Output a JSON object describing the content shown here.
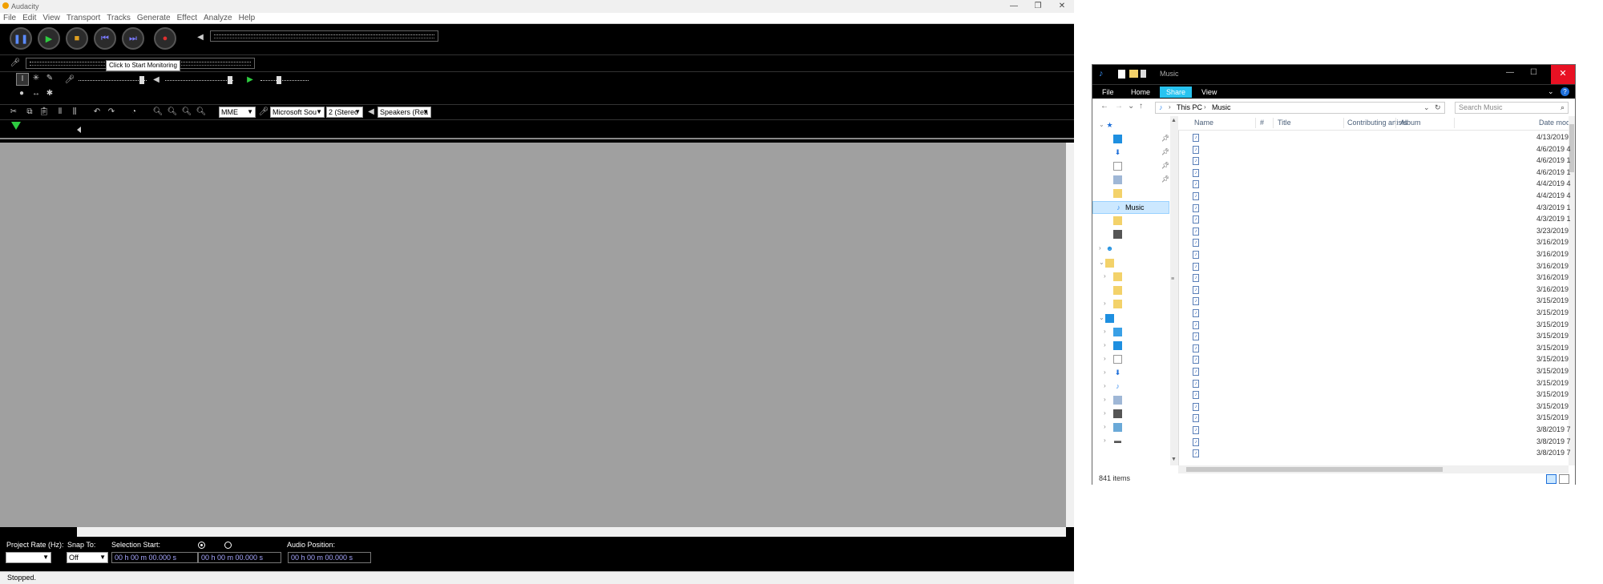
{
  "audacity": {
    "title": "Audacity",
    "menu": [
      "File",
      "Edit",
      "View",
      "Transport",
      "Tracks",
      "Generate",
      "Effect",
      "Analyze",
      "Help"
    ],
    "tooltip": "Click to Start Monitoring",
    "host": "MME",
    "recording_device": "Microsoft Sou",
    "channels": "2 (Stereo",
    "playback_device": "Speakers (Rea",
    "bottom": {
      "project_rate_label": "Project Rate (Hz):",
      "project_rate_value": "",
      "snap_to_label": "Snap To:",
      "snap_to_value": "Off",
      "selection_start_label": "Selection Start:",
      "audio_position_label": "Audio Position:",
      "selection_start_value": "00 h 00 m 00.000 s",
      "selection_end_value": "00 h 00 m 00.000 s",
      "audio_position_value": "00 h 00 m 00.000 s"
    },
    "status": "Stopped."
  },
  "explorer": {
    "title": "Music",
    "ribbon_tabs": [
      "File",
      "Home",
      "Share",
      "View"
    ],
    "active_tab": "Share",
    "breadcrumb": [
      "This PC",
      "Music"
    ],
    "search_placeholder": "Search Music",
    "nav_selected": "Music",
    "columns": [
      "Name",
      "#",
      "Title",
      "Contributing artists",
      "Album",
      "Date modi"
    ],
    "dates": [
      "4/13/2019",
      "4/6/2019 4",
      "4/6/2019 1",
      "4/6/2019 1",
      "4/4/2019 4",
      "4/4/2019 4",
      "4/3/2019 1",
      "4/3/2019 1",
      "3/23/2019",
      "3/16/2019",
      "3/16/2019",
      "3/16/2019",
      "3/16/2019",
      "3/16/2019",
      "3/15/2019",
      "3/15/2019",
      "3/15/2019",
      "3/15/2019",
      "3/15/2019",
      "3/15/2019",
      "3/15/2019",
      "3/15/2019",
      "3/15/2019",
      "3/15/2019",
      "3/15/2019",
      "3/8/2019 7",
      "3/8/2019 7",
      "3/8/2019 7"
    ],
    "item_count": "841 items",
    "colors": {
      "active_tab": "#27c3f0",
      "selection": "#cce8ff",
      "titlebar": "#000000"
    }
  }
}
